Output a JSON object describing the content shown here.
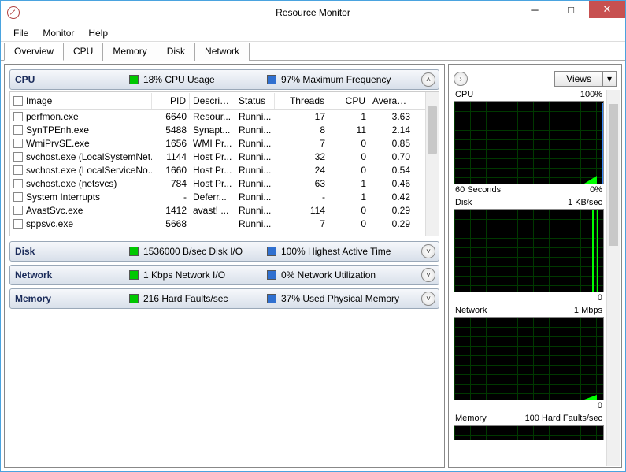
{
  "window": {
    "title": "Resource Monitor"
  },
  "menu": {
    "file": "File",
    "monitor": "Monitor",
    "help": "Help"
  },
  "tabs": {
    "overview": "Overview",
    "cpu": "CPU",
    "memory": "Memory",
    "disk": "Disk",
    "network": "Network"
  },
  "cpu_header": {
    "title": "CPU",
    "usage": "18% CPU Usage",
    "freq": "97% Maximum Frequency"
  },
  "columns": {
    "image": "Image",
    "pid": "PID",
    "desc": "Descrip...",
    "status": "Status",
    "threads": "Threads",
    "cpu": "CPU",
    "avg": "Averag..."
  },
  "processes": [
    {
      "image": "perfmon.exe",
      "pid": "6640",
      "desc": "Resour...",
      "status": "Runni...",
      "threads": "17",
      "cpu": "1",
      "avg": "3.63"
    },
    {
      "image": "SynTPEnh.exe",
      "pid": "5488",
      "desc": "Synapt...",
      "status": "Runni...",
      "threads": "8",
      "cpu": "11",
      "avg": "2.14"
    },
    {
      "image": "WmiPrvSE.exe",
      "pid": "1656",
      "desc": "WMI Pr...",
      "status": "Runni...",
      "threads": "7",
      "cpu": "0",
      "avg": "0.85"
    },
    {
      "image": "svchost.exe (LocalSystemNet...",
      "pid": "1144",
      "desc": "Host Pr...",
      "status": "Runni...",
      "threads": "32",
      "cpu": "0",
      "avg": "0.70"
    },
    {
      "image": "svchost.exe (LocalServiceNo...",
      "pid": "1660",
      "desc": "Host Pr...",
      "status": "Runni...",
      "threads": "24",
      "cpu": "0",
      "avg": "0.54"
    },
    {
      "image": "svchost.exe (netsvcs)",
      "pid": "784",
      "desc": "Host Pr...",
      "status": "Runni...",
      "threads": "63",
      "cpu": "1",
      "avg": "0.46"
    },
    {
      "image": "System Interrupts",
      "pid": "-",
      "desc": "Deferr...",
      "status": "Runni...",
      "threads": "-",
      "cpu": "1",
      "avg": "0.42"
    },
    {
      "image": "AvastSvc.exe",
      "pid": "1412",
      "desc": "avast! ...",
      "status": "Runni...",
      "threads": "114",
      "cpu": "0",
      "avg": "0.29"
    },
    {
      "image": "sppsvc.exe",
      "pid": "5668",
      "desc": "",
      "status": "Runni...",
      "threads": "7",
      "cpu": "0",
      "avg": "0.29"
    }
  ],
  "disk_header": {
    "title": "Disk",
    "io": "1536000 B/sec Disk I/O",
    "active": "100% Highest Active Time"
  },
  "net_header": {
    "title": "Network",
    "io": "1 Kbps Network I/O",
    "util": "0% Network Utilization"
  },
  "mem_header": {
    "title": "Memory",
    "faults": "216 Hard Faults/sec",
    "used": "37% Used Physical Memory"
  },
  "right": {
    "views": "Views",
    "g1": {
      "title": "CPU",
      "right": "100%",
      "footL": "60 Seconds",
      "footR": "0%"
    },
    "g2": {
      "title": "Disk",
      "right": "1 KB/sec",
      "footR": "0"
    },
    "g3": {
      "title": "Network",
      "right": "1 Mbps",
      "footR": "0"
    },
    "g4": {
      "title": "Memory",
      "right": "100 Hard Faults/sec"
    }
  }
}
